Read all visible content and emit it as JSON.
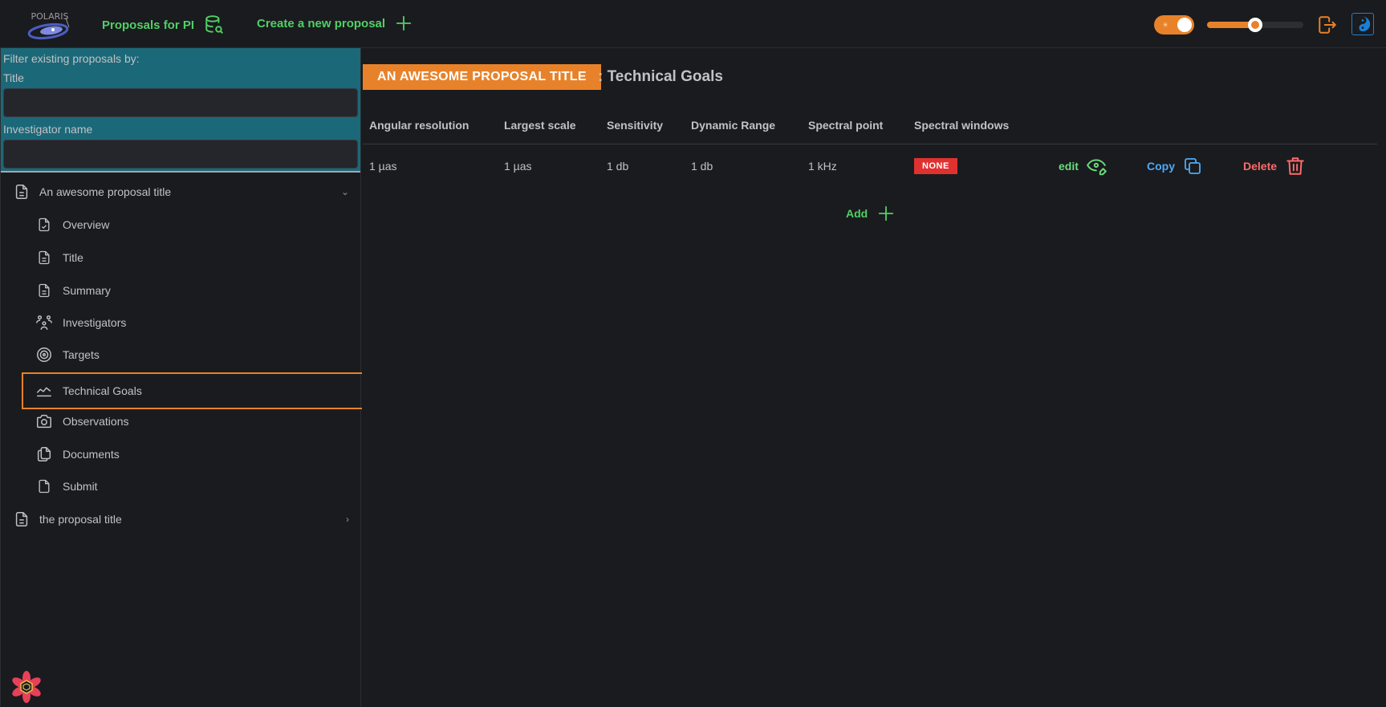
{
  "app": {
    "logo_text": "POLARIS"
  },
  "topbar": {
    "proposals_for_pi_label": "Proposals for PI",
    "create_proposal_label": "Create a new proposal",
    "theme_toggle_on": true,
    "slider_value_percent": 50
  },
  "sidebar": {
    "filter_heading": "Filter existing proposals by:",
    "title_filter_label": "Title",
    "title_filter_value": "",
    "investigator_filter_label": "Investigator name",
    "investigator_filter_value": "",
    "proposals": [
      {
        "label": "An awesome proposal title",
        "expanded": true,
        "children": [
          {
            "label": "Overview",
            "icon": "file-check-icon"
          },
          {
            "label": "Title",
            "icon": "file-text-icon"
          },
          {
            "label": "Summary",
            "icon": "file-text-icon"
          },
          {
            "label": "Investigators",
            "icon": "users-group-icon"
          },
          {
            "label": "Targets",
            "icon": "target-icon"
          },
          {
            "label": "Technical Goals",
            "icon": "chart-line-icon",
            "active": true
          },
          {
            "label": "Observations",
            "icon": "camera-icon"
          },
          {
            "label": "Documents",
            "icon": "files-icon"
          },
          {
            "label": "Submit",
            "icon": "file-icon"
          }
        ]
      },
      {
        "label": "the proposal title",
        "expanded": false
      }
    ]
  },
  "main": {
    "proposal_title": "AN AWESOME PROPOSAL TITLE",
    "page_title": ": Technical Goals",
    "table": {
      "headers": [
        "Angular resolution",
        "Largest scale",
        "Sensitivity",
        "Dynamic Range",
        "Spectral point",
        "Spectral windows"
      ],
      "rows": [
        {
          "angular_resolution": "1 µas",
          "largest_scale": "1 µas",
          "sensitivity": "1 db",
          "dynamic_range": "1 db",
          "spectral_point": "1 kHz",
          "spectral_windows": "NONE",
          "edit_label": "edit",
          "copy_label": "Copy",
          "delete_label": "Delete"
        }
      ]
    },
    "add_label": "Add"
  },
  "colors": {
    "accent_orange": "#e8822a",
    "success_green": "#51cf66",
    "danger_red": "#e03131",
    "info_blue": "#4dabf7",
    "filter_panel_teal": "#1b6878"
  }
}
